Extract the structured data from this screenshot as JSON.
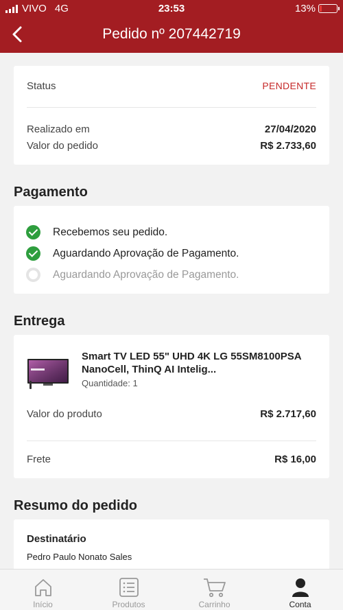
{
  "statusbar": {
    "carrier": "VIVO",
    "network": "4G",
    "time": "23:53",
    "battery": "13%",
    "battery_level": 0.13
  },
  "header": {
    "title": "Pedido nº 207442719"
  },
  "order": {
    "status_label": "Status",
    "status_value": "PENDENTE",
    "placed_label": "Realizado em",
    "placed_value": "27/04/2020",
    "total_label": "Valor do pedido",
    "total_value": "R$  2.733,60"
  },
  "payment": {
    "title": "Pagamento",
    "steps": [
      {
        "label": "Recebemos seu pedido.",
        "done": true
      },
      {
        "label": "Aguardando Aprovação de Pagamento.",
        "done": true
      },
      {
        "label": "Aguardando Aprovação de Pagamento.",
        "done": false
      }
    ]
  },
  "delivery": {
    "title": "Entrega",
    "product_name": "Smart TV LED 55\" UHD 4K LG 55SM8100PSA NanoCell, ThinQ AI Intelig...",
    "quantity": "Quantidade: 1",
    "product_value_label": "Valor do produto",
    "product_value": "R$  2.717,60",
    "shipping_label": "Frete",
    "shipping_value": "R$  16,00"
  },
  "summary": {
    "title": "Resumo do pedido",
    "recipient_label": "Destinatário",
    "recipient_name": "Pedro Paulo Nonato Sales"
  },
  "tabbar": {
    "items": [
      {
        "label": "Início",
        "icon": "home-icon",
        "active": false
      },
      {
        "label": "Produtos",
        "icon": "list-icon",
        "active": false
      },
      {
        "label": "Carrinho",
        "icon": "cart-icon",
        "active": false
      },
      {
        "label": "Conta",
        "icon": "user-icon",
        "active": true
      }
    ]
  },
  "colors": {
    "brand": "#a31d22",
    "status_pending": "#c62828",
    "success": "#2e9e3e"
  }
}
